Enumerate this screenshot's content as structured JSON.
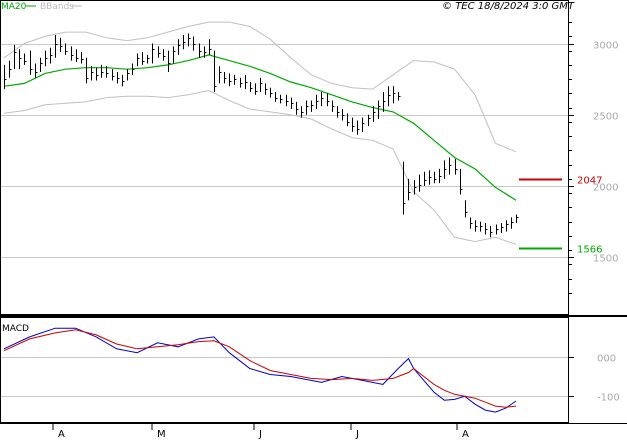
{
  "header": {
    "ma_legend": "MA20",
    "bb_legend": "BBands",
    "copyright": "© TEC 18/8/2024 3:0 GMT"
  },
  "macd_label": "MACD",
  "colors": {
    "price": "#000000",
    "ma20": "#00aa00",
    "bbands": "#c0c0c0",
    "resistance": "#cc0000",
    "support": "#00aa00",
    "macd": "#0000cc",
    "signal": "#cc0000",
    "grid": "#c8c8c8"
  },
  "chart_data": [
    {
      "type": "line",
      "name": "price",
      "y_ticks": [
        3000,
        2500,
        2000,
        1500
      ],
      "y_tick_labels": [
        "3000",
        "2500",
        "2000",
        "1500"
      ],
      "ylim": [
        1200,
        3200
      ],
      "x_labels": [
        "A",
        "M",
        "J",
        "J",
        "A"
      ],
      "levels": [
        {
          "label": "2047",
          "value": 2047,
          "color": "#cc0000"
        },
        {
          "label": "1566",
          "value": 1566,
          "color": "#00aa00"
        }
      ],
      "candles": [
        {
          "h": 2850,
          "l": 2680,
          "c": 2750
        },
        {
          "h": 2880,
          "l": 2760,
          "c": 2820
        },
        {
          "h": 2990,
          "l": 2820,
          "c": 2940
        },
        {
          "h": 2960,
          "l": 2820,
          "c": 2900
        },
        {
          "h": 2930,
          "l": 2850,
          "c": 2880
        },
        {
          "h": 2950,
          "l": 2780,
          "c": 2820
        },
        {
          "h": 2860,
          "l": 2760,
          "c": 2800
        },
        {
          "h": 2900,
          "l": 2800,
          "c": 2860
        },
        {
          "h": 2950,
          "l": 2840,
          "c": 2900
        },
        {
          "h": 2970,
          "l": 2860,
          "c": 2920
        },
        {
          "h": 3060,
          "l": 2900,
          "c": 3000
        },
        {
          "h": 3040,
          "l": 2940,
          "c": 2980
        },
        {
          "h": 3000,
          "l": 2920,
          "c": 2950
        },
        {
          "h": 2980,
          "l": 2880,
          "c": 2920
        },
        {
          "h": 2960,
          "l": 2870,
          "c": 2900
        },
        {
          "h": 2940,
          "l": 2860,
          "c": 2890
        },
        {
          "h": 2900,
          "l": 2720,
          "c": 2760
        },
        {
          "h": 2840,
          "l": 2740,
          "c": 2800
        },
        {
          "h": 2830,
          "l": 2740,
          "c": 2780
        },
        {
          "h": 2850,
          "l": 2760,
          "c": 2800
        },
        {
          "h": 2840,
          "l": 2760,
          "c": 2790
        },
        {
          "h": 2820,
          "l": 2740,
          "c": 2770
        },
        {
          "h": 2800,
          "l": 2720,
          "c": 2760
        },
        {
          "h": 2780,
          "l": 2700,
          "c": 2740
        },
        {
          "h": 2820,
          "l": 2740,
          "c": 2790
        },
        {
          "h": 2860,
          "l": 2780,
          "c": 2820
        },
        {
          "h": 2930,
          "l": 2840,
          "c": 2900
        },
        {
          "h": 2940,
          "l": 2850,
          "c": 2880
        },
        {
          "h": 2920,
          "l": 2860,
          "c": 2900
        },
        {
          "h": 3000,
          "l": 2860,
          "c": 2960
        },
        {
          "h": 2980,
          "l": 2900,
          "c": 2930
        },
        {
          "h": 2960,
          "l": 2880,
          "c": 2910
        },
        {
          "h": 2950,
          "l": 2800,
          "c": 2860
        },
        {
          "h": 2980,
          "l": 2860,
          "c": 2950
        },
        {
          "h": 3030,
          "l": 2920,
          "c": 2990
        },
        {
          "h": 3060,
          "l": 2960,
          "c": 3010
        },
        {
          "h": 3070,
          "l": 2980,
          "c": 3040
        },
        {
          "h": 3050,
          "l": 2950,
          "c": 3000
        },
        {
          "h": 3000,
          "l": 2900,
          "c": 2950
        },
        {
          "h": 2980,
          "l": 2900,
          "c": 2940
        },
        {
          "h": 3030,
          "l": 2920,
          "c": 2960
        },
        {
          "h": 2950,
          "l": 2660,
          "c": 2700
        },
        {
          "h": 2840,
          "l": 2720,
          "c": 2800
        },
        {
          "h": 2800,
          "l": 2720,
          "c": 2760
        },
        {
          "h": 2790,
          "l": 2700,
          "c": 2740
        },
        {
          "h": 2780,
          "l": 2710,
          "c": 2750
        },
        {
          "h": 2760,
          "l": 2690,
          "c": 2720
        },
        {
          "h": 2780,
          "l": 2680,
          "c": 2730
        },
        {
          "h": 2730,
          "l": 2660,
          "c": 2690
        },
        {
          "h": 2720,
          "l": 2640,
          "c": 2670
        },
        {
          "h": 2760,
          "l": 2660,
          "c": 2720
        },
        {
          "h": 2720,
          "l": 2640,
          "c": 2680
        },
        {
          "h": 2690,
          "l": 2620,
          "c": 2650
        },
        {
          "h": 2660,
          "l": 2590,
          "c": 2620
        },
        {
          "h": 2640,
          "l": 2580,
          "c": 2610
        },
        {
          "h": 2640,
          "l": 2560,
          "c": 2600
        },
        {
          "h": 2620,
          "l": 2540,
          "c": 2580
        },
        {
          "h": 2590,
          "l": 2500,
          "c": 2540
        },
        {
          "h": 2560,
          "l": 2480,
          "c": 2520
        },
        {
          "h": 2600,
          "l": 2500,
          "c": 2560
        },
        {
          "h": 2600,
          "l": 2520,
          "c": 2570
        },
        {
          "h": 2640,
          "l": 2540,
          "c": 2600
        },
        {
          "h": 2660,
          "l": 2560,
          "c": 2620
        },
        {
          "h": 2650,
          "l": 2560,
          "c": 2600
        },
        {
          "h": 2600,
          "l": 2520,
          "c": 2560
        },
        {
          "h": 2560,
          "l": 2480,
          "c": 2520
        },
        {
          "h": 2540,
          "l": 2460,
          "c": 2500
        },
        {
          "h": 2510,
          "l": 2420,
          "c": 2450
        },
        {
          "h": 2480,
          "l": 2380,
          "c": 2420
        },
        {
          "h": 2460,
          "l": 2360,
          "c": 2400
        },
        {
          "h": 2480,
          "l": 2380,
          "c": 2440
        },
        {
          "h": 2500,
          "l": 2420,
          "c": 2480
        },
        {
          "h": 2560,
          "l": 2450,
          "c": 2520
        },
        {
          "h": 2600,
          "l": 2470,
          "c": 2560
        },
        {
          "h": 2660,
          "l": 2520,
          "c": 2600
        },
        {
          "h": 2700,
          "l": 2560,
          "c": 2640
        },
        {
          "h": 2700,
          "l": 2580,
          "c": 2650
        },
        {
          "h": 2660,
          "l": 2600,
          "c": 2630
        },
        {
          "h": 2170,
          "l": 1800,
          "c": 1880
        },
        {
          "h": 2050,
          "l": 1900,
          "c": 1960
        },
        {
          "h": 2040,
          "l": 1940,
          "c": 1990
        },
        {
          "h": 2080,
          "l": 1960,
          "c": 2010
        },
        {
          "h": 2100,
          "l": 2000,
          "c": 2040
        },
        {
          "h": 2110,
          "l": 2010,
          "c": 2060
        },
        {
          "h": 2100,
          "l": 2020,
          "c": 2050
        },
        {
          "h": 2120,
          "l": 2020,
          "c": 2070
        },
        {
          "h": 2180,
          "l": 2050,
          "c": 2120
        },
        {
          "h": 2200,
          "l": 2080,
          "c": 2150
        },
        {
          "h": 2190,
          "l": 2080,
          "c": 2120
        },
        {
          "h": 2120,
          "l": 1940,
          "c": 1980
        },
        {
          "h": 1900,
          "l": 1780,
          "c": 1820
        },
        {
          "h": 1780,
          "l": 1700,
          "c": 1740
        },
        {
          "h": 1760,
          "l": 1680,
          "c": 1720
        },
        {
          "h": 1750,
          "l": 1680,
          "c": 1720
        },
        {
          "h": 1740,
          "l": 1660,
          "c": 1700
        },
        {
          "h": 1720,
          "l": 1640,
          "c": 1680
        },
        {
          "h": 1730,
          "l": 1660,
          "c": 1700
        },
        {
          "h": 1740,
          "l": 1670,
          "c": 1710
        },
        {
          "h": 1760,
          "l": 1680,
          "c": 1730
        },
        {
          "h": 1780,
          "l": 1700,
          "c": 1750
        },
        {
          "h": 1800,
          "l": 1740,
          "c": 1780
        }
      ],
      "ma20": [
        [
          0,
          2700
        ],
        [
          4,
          2720
        ],
        [
          8,
          2790
        ],
        [
          12,
          2820
        ],
        [
          16,
          2830
        ],
        [
          20,
          2830
        ],
        [
          24,
          2820
        ],
        [
          28,
          2830
        ],
        [
          32,
          2850
        ],
        [
          36,
          2880
        ],
        [
          40,
          2920
        ],
        [
          44,
          2880
        ],
        [
          48,
          2840
        ],
        [
          52,
          2790
        ],
        [
          56,
          2730
        ],
        [
          60,
          2690
        ],
        [
          64,
          2640
        ],
        [
          68,
          2590
        ],
        [
          72,
          2550
        ],
        [
          76,
          2520
        ],
        [
          80,
          2440
        ],
        [
          84,
          2320
        ],
        [
          88,
          2200
        ],
        [
          92,
          2120
        ],
        [
          96,
          1990
        ],
        [
          100,
          1900
        ]
      ],
      "bb_upper": [
        [
          0,
          2900
        ],
        [
          4,
          3000
        ],
        [
          8,
          3050
        ],
        [
          12,
          3080
        ],
        [
          16,
          3080
        ],
        [
          20,
          3040
        ],
        [
          24,
          3020
        ],
        [
          28,
          3040
        ],
        [
          32,
          3080
        ],
        [
          36,
          3120
        ],
        [
          40,
          3150
        ],
        [
          44,
          3150
        ],
        [
          48,
          3120
        ],
        [
          52,
          3030
        ],
        [
          56,
          2900
        ],
        [
          60,
          2780
        ],
        [
          64,
          2720
        ],
        [
          68,
          2690
        ],
        [
          72,
          2680
        ],
        [
          76,
          2780
        ],
        [
          80,
          2880
        ],
        [
          84,
          2870
        ],
        [
          88,
          2820
        ],
        [
          92,
          2640
        ],
        [
          96,
          2300
        ],
        [
          100,
          2240
        ]
      ],
      "bb_lower": [
        [
          0,
          2510
        ],
        [
          4,
          2530
        ],
        [
          8,
          2570
        ],
        [
          12,
          2580
        ],
        [
          16,
          2590
        ],
        [
          20,
          2620
        ],
        [
          24,
          2630
        ],
        [
          28,
          2630
        ],
        [
          32,
          2620
        ],
        [
          36,
          2640
        ],
        [
          40,
          2670
        ],
        [
          44,
          2600
        ],
        [
          48,
          2540
        ],
        [
          52,
          2520
        ],
        [
          56,
          2500
        ],
        [
          60,
          2470
        ],
        [
          64,
          2400
        ],
        [
          68,
          2340
        ],
        [
          72,
          2320
        ],
        [
          76,
          2260
        ],
        [
          80,
          1960
        ],
        [
          84,
          1830
        ],
        [
          88,
          1640
        ],
        [
          92,
          1610
        ],
        [
          96,
          1640
        ],
        [
          100,
          1590
        ]
      ]
    },
    {
      "type": "line",
      "name": "MACD",
      "y_ticks": [
        0,
        -100
      ],
      "y_tick_labels": [
        "000",
        "-100"
      ],
      "ylim": [
        -160,
        80
      ],
      "series": [
        {
          "name": "macd",
          "color": "#0000cc",
          "points": [
            [
              0,
              20
            ],
            [
              5,
              50
            ],
            [
              10,
              72
            ],
            [
              14,
              72
            ],
            [
              18,
              50
            ],
            [
              22,
              20
            ],
            [
              26,
              10
            ],
            [
              30,
              35
            ],
            [
              34,
              25
            ],
            [
              38,
              45
            ],
            [
              41,
              50
            ],
            [
              44,
              10
            ],
            [
              48,
              -30
            ],
            [
              52,
              -45
            ],
            [
              56,
              -50
            ],
            [
              60,
              -60
            ],
            [
              62,
              -65
            ],
            [
              66,
              -50
            ],
            [
              70,
              -60
            ],
            [
              74,
              -70
            ],
            [
              77,
              -30
            ],
            [
              79,
              -5
            ],
            [
              80,
              -30
            ],
            [
              82,
              -60
            ],
            [
              84,
              -90
            ],
            [
              86,
              -110
            ],
            [
              88,
              -108
            ],
            [
              90,
              -100
            ],
            [
              92,
              -120
            ],
            [
              94,
              -135
            ],
            [
              96,
              -140
            ],
            [
              98,
              -130
            ],
            [
              100,
              -112
            ]
          ]
        },
        {
          "name": "signal",
          "color": "#cc0000",
          "points": [
            [
              0,
              15
            ],
            [
              5,
              45
            ],
            [
              10,
              60
            ],
            [
              14,
              68
            ],
            [
              18,
              55
            ],
            [
              22,
              32
            ],
            [
              26,
              20
            ],
            [
              30,
              25
            ],
            [
              34,
              30
            ],
            [
              38,
              38
            ],
            [
              41,
              40
            ],
            [
              44,
              25
            ],
            [
              48,
              -10
            ],
            [
              52,
              -35
            ],
            [
              56,
              -45
            ],
            [
              60,
              -55
            ],
            [
              64,
              -58
            ],
            [
              68,
              -55
            ],
            [
              72,
              -60
            ],
            [
              76,
              -55
            ],
            [
              79,
              -40
            ],
            [
              80,
              -30
            ],
            [
              82,
              -50
            ],
            [
              84,
              -70
            ],
            [
              86,
              -85
            ],
            [
              88,
              -95
            ],
            [
              90,
              -100
            ],
            [
              92,
              -105
            ],
            [
              94,
              -115
            ],
            [
              96,
              -125
            ],
            [
              98,
              -128
            ],
            [
              100,
              -125
            ]
          ]
        }
      ]
    }
  ]
}
